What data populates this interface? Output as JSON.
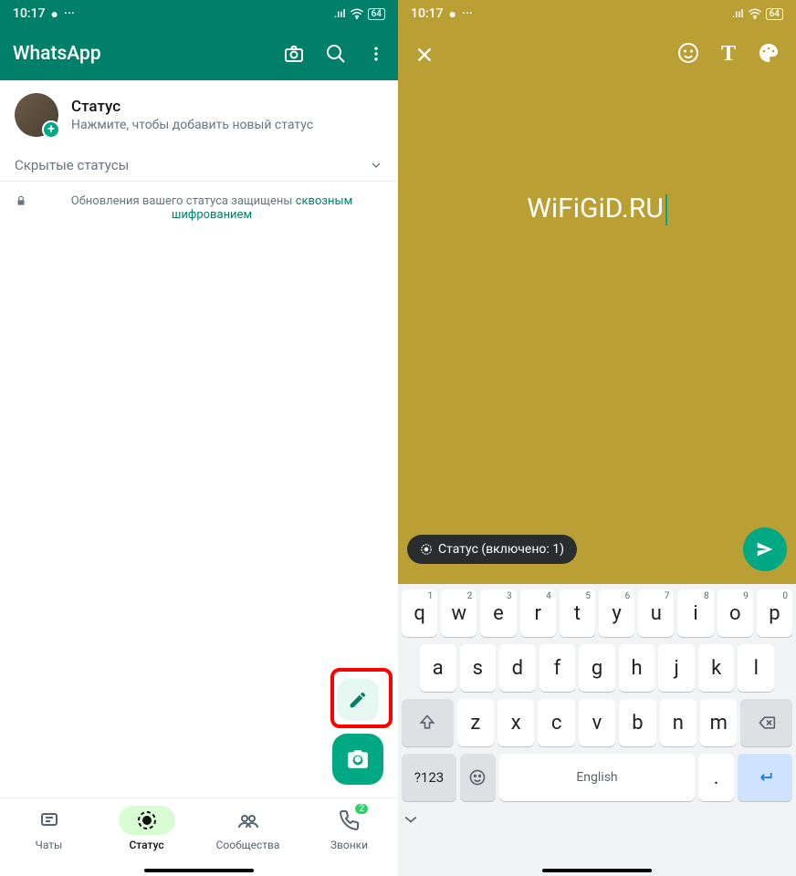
{
  "left": {
    "statusbar": {
      "time": "10:17",
      "battery": "64"
    },
    "header": {
      "title": "WhatsApp"
    },
    "status": {
      "title": "Статус",
      "subtitle": "Нажмите, чтобы добавить новый статус"
    },
    "muted": {
      "label": "Скрытые статусы"
    },
    "encrypt": {
      "text": "Обновления вашего статуса защищены ",
      "link": "сквозным шифрованием"
    },
    "nav": {
      "chats": "Чаты",
      "status": "Статус",
      "community": "Сообщества",
      "calls": "Звонки",
      "badge": "2"
    }
  },
  "right": {
    "statusbar": {
      "time": "10:17",
      "battery": "64"
    },
    "text": "WiFiGiD.RU",
    "chip": "Статус (включено: 1)",
    "kbd": {
      "r1": [
        "q",
        "w",
        "e",
        "r",
        "t",
        "y",
        "u",
        "i",
        "o",
        "p"
      ],
      "sup1": [
        "1",
        "2",
        "3",
        "4",
        "5",
        "6",
        "7",
        "8",
        "9",
        "0"
      ],
      "r2": [
        "a",
        "s",
        "d",
        "f",
        "g",
        "h",
        "j",
        "k",
        "l"
      ],
      "r3": [
        "z",
        "x",
        "c",
        "v",
        "b",
        "n",
        "m"
      ],
      "sym": "?123",
      "lang": "English",
      "dot": "."
    }
  }
}
